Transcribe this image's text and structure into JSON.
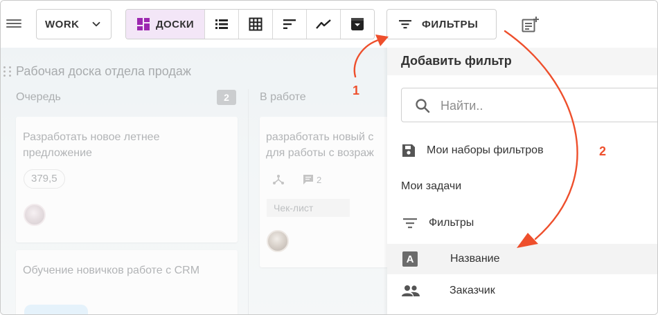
{
  "toolbar": {
    "workspace": "WORK",
    "views": {
      "active_label": "ДОСКИ"
    },
    "filters_label": "ФИЛЬТРЫ"
  },
  "board": {
    "title": "Рабочая доска отдела продаж",
    "columns": [
      {
        "title": "Очередь",
        "count": "2",
        "cards": [
          {
            "title": "Разработать новое летнее предложение",
            "badge": "379,5"
          },
          {
            "title": "Обучение новичков работе с CRM"
          }
        ]
      },
      {
        "title": "В работе",
        "cards": [
          {
            "title_line1": "разработать новый с",
            "title_line2": "для работы с возраж",
            "comments": "2",
            "checklist": "Чек-лист"
          }
        ]
      }
    ]
  },
  "filter_panel": {
    "title": "Добавить фильтр",
    "search_placeholder": "Найти..",
    "saved_sets": "Мои наборы фильтров",
    "my_tasks": "Мои задачи",
    "filters_section": "Фильтры",
    "fields": [
      {
        "label": "Название",
        "icon": "text-format-icon",
        "icon_letter": "A"
      },
      {
        "label": "Заказчик",
        "icon": "people-icon"
      }
    ]
  },
  "annotations": {
    "step1": "1",
    "step2": "2",
    "color": "#ee4f2c"
  },
  "colors": {
    "accent_active_view": "#f3e6f7",
    "board_icon": "#9c27b0",
    "column_count_badge": "#a6aaad"
  }
}
